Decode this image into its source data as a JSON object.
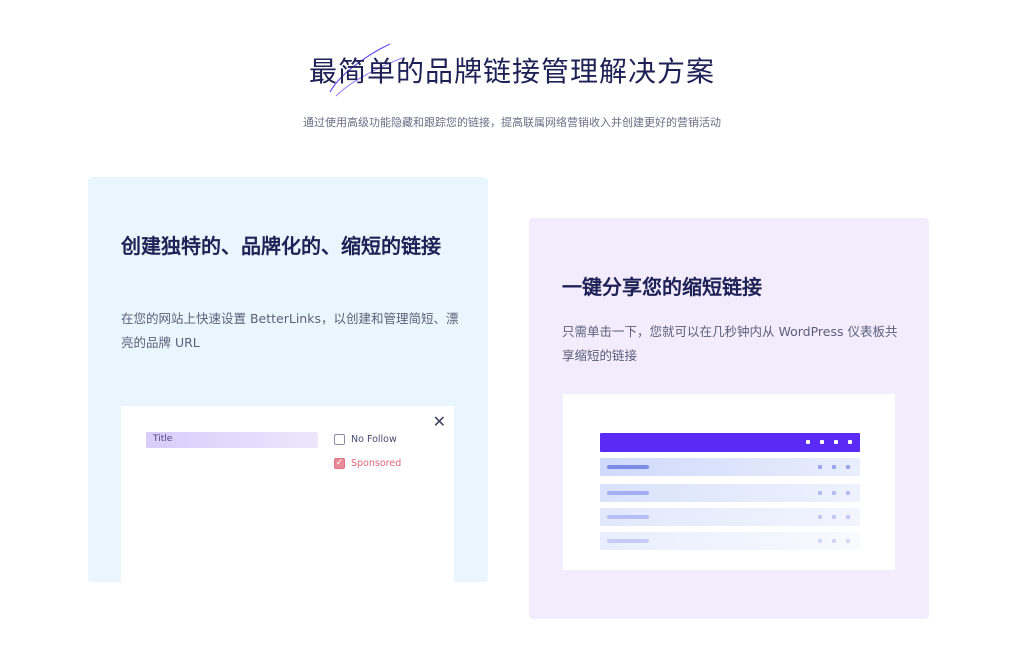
{
  "hero": {
    "title": "最简单的品牌链接管理解决方案",
    "subtitle": "通过使用高级功能隐藏和跟踪您的链接，提高联属网络营销收入并创建更好的营销活动"
  },
  "features": [
    {
      "title": "创建独特的、品牌化的、缩短的链接",
      "description": "在您的网站上快速设置 BetterLinks，以创建和管理简短、漂亮的品牌 URL",
      "mockup": {
        "title_field_label": "Title",
        "checkboxes": [
          {
            "label": "No Follow",
            "checked": false
          },
          {
            "label": "Sponsored",
            "checked": true
          }
        ]
      }
    },
    {
      "title": "一键分享您的缩短链接",
      "description": "只需单击一下，您就可以在几秒钟内从 WordPress 仪表板共享缩短的链接"
    }
  ],
  "colors": {
    "heading": "#1e2155",
    "left_card_bg": "#eaf6fd",
    "right_card_bg": "#f2ecfd",
    "accent_purple": "#5b2bf5",
    "sponsored_red": "#e0667a"
  },
  "icons": {
    "close": "close-icon",
    "checkbox": "checkbox-icon"
  }
}
